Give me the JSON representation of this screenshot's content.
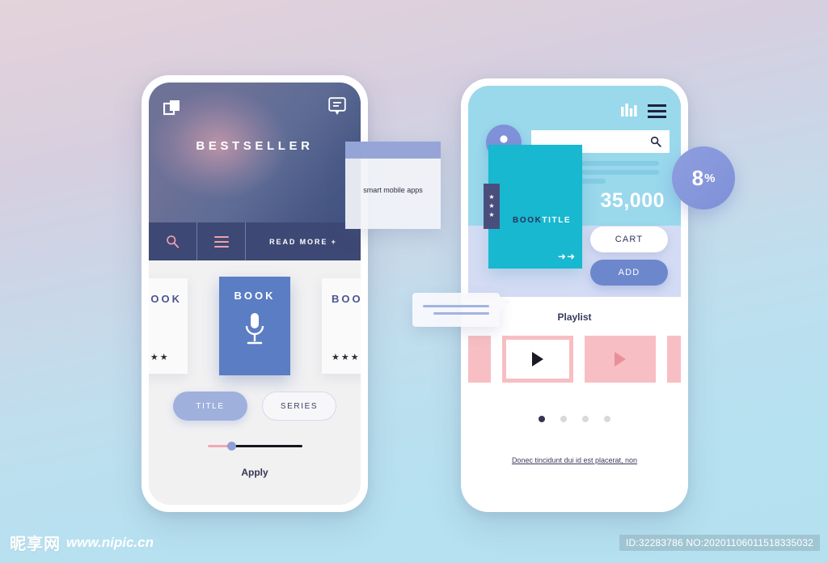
{
  "watermark": {
    "logo": "昵享网",
    "url": "www.nipic.cn",
    "id_text": "ID:32283786 NO:20201106011518335032"
  },
  "colors": {
    "bg_top": "#e3d3da",
    "bg_bottom": "#b4e0ef",
    "hero_navy": "#3d4874",
    "accent_pink": "#f0a0ac",
    "accent_blue": "#5b7dc4",
    "cyan_header": "#9ad8ec",
    "cover_teal": "#17b8d0",
    "lavender": "#d4dcf4",
    "badge_blue": "#7f90d8",
    "thumb_pink": "#f7bec3"
  },
  "left_phone": {
    "hero": {
      "layers_icon": "layers-icon",
      "chat_icon": "chat-bubble-icon",
      "title": "BESTSELLER"
    },
    "actionbar": {
      "search_icon": "search-icon",
      "menu_icon": "hamburger-menu-icon",
      "read_more_label": "READ MORE +"
    },
    "books": [
      {
        "title": "BOOK",
        "stars": "★★★"
      },
      {
        "title": "BOOK",
        "stars": "",
        "icon": "microphone-icon"
      },
      {
        "title": "BOO",
        "stars": "★★★"
      }
    ],
    "filters": {
      "title_label": "TITLE",
      "series_label": "SERIES"
    },
    "slider": {
      "value": 21
    },
    "apply_label": "Apply"
  },
  "right_phone": {
    "header": {
      "chart_icon": "bar-chart-icon",
      "menu_icon": "hamburger-menu-icon",
      "avatar_icon": "user-avatar-icon",
      "search_icon": "search-icon",
      "search_value": "",
      "search_placeholder": ""
    },
    "product": {
      "cover_title_bold": "BOOK",
      "cover_title_light": "TITLE",
      "cover_stars": [
        "★",
        "★",
        "★"
      ],
      "cover_arrows": "➜➜",
      "price": "35,000",
      "cart_label": "CART",
      "add_label": "ADD"
    },
    "playlist": {
      "label": "Playlist",
      "thumbs": [
        "",
        "",
        "",
        ""
      ],
      "dots": [
        true,
        false,
        false,
        false
      ]
    },
    "footer_link": "Donec tincidunt dui id est placerat, non"
  },
  "overlays": {
    "tooltip_text": "smart mobile apps",
    "chat_bubble": "chat-bubble-overlay",
    "discount_number": "8",
    "discount_percent": "%"
  }
}
